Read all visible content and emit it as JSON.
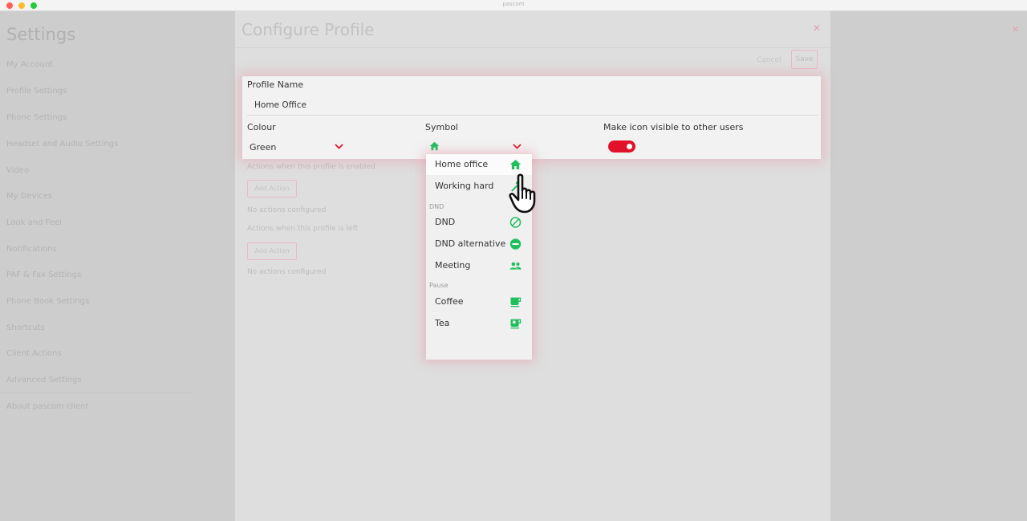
{
  "window": {
    "title": "pascom"
  },
  "sidebar": {
    "title": "Settings",
    "items": [
      "My Account",
      "Profile Settings",
      "Phone Settings",
      "Headset and Audio Settings",
      "Video",
      "My Devices",
      "Look and Feel",
      "Notifications",
      "PAF & Fax Settings",
      "Phone Book Settings",
      "Shortcuts",
      "Client Actions",
      "Advanced Settings",
      "About pascom client"
    ]
  },
  "dialog": {
    "title": "Configure Profile",
    "cancel_label": "Cancel",
    "save_label": "Save",
    "actions_enabled_label": "Actions when this profile is enabled",
    "add_action_label_1": "Add Action",
    "no_actions_1": "No actions configured",
    "actions_left_label": "Actions when this profile is left",
    "add_action_label_2": "Add Action",
    "no_actions_2": "No actions configured"
  },
  "form": {
    "profile_name_label": "Profile Name",
    "profile_name_value": "Home Office",
    "colour_label": "Colour",
    "colour_value": "Green",
    "symbol_label": "Symbol",
    "symbol_value_icon": "home-icon",
    "visible_label": "Make icon visible to other users",
    "visible_toggle_on": true
  },
  "symbol_dropdown": {
    "items": [
      {
        "label": "Home office",
        "icon": "home-icon"
      },
      {
        "label": "Working hard",
        "icon": "hammer-icon"
      }
    ],
    "group_dnd": "DND",
    "dnd_items": [
      {
        "label": "DND",
        "icon": "do-not-disturb-icon"
      },
      {
        "label": "DND alternative",
        "icon": "minus-circle-icon"
      },
      {
        "label": "Meeting",
        "icon": "people-icon"
      }
    ],
    "group_pause": "Pause",
    "pause_items": [
      {
        "label": "Coffee",
        "icon": "coffee-cup-icon"
      },
      {
        "label": "Tea",
        "icon": "tea-cup-icon"
      }
    ]
  },
  "colors": {
    "accent_red": "#e1112a",
    "icon_green": "#1fbf5c"
  }
}
